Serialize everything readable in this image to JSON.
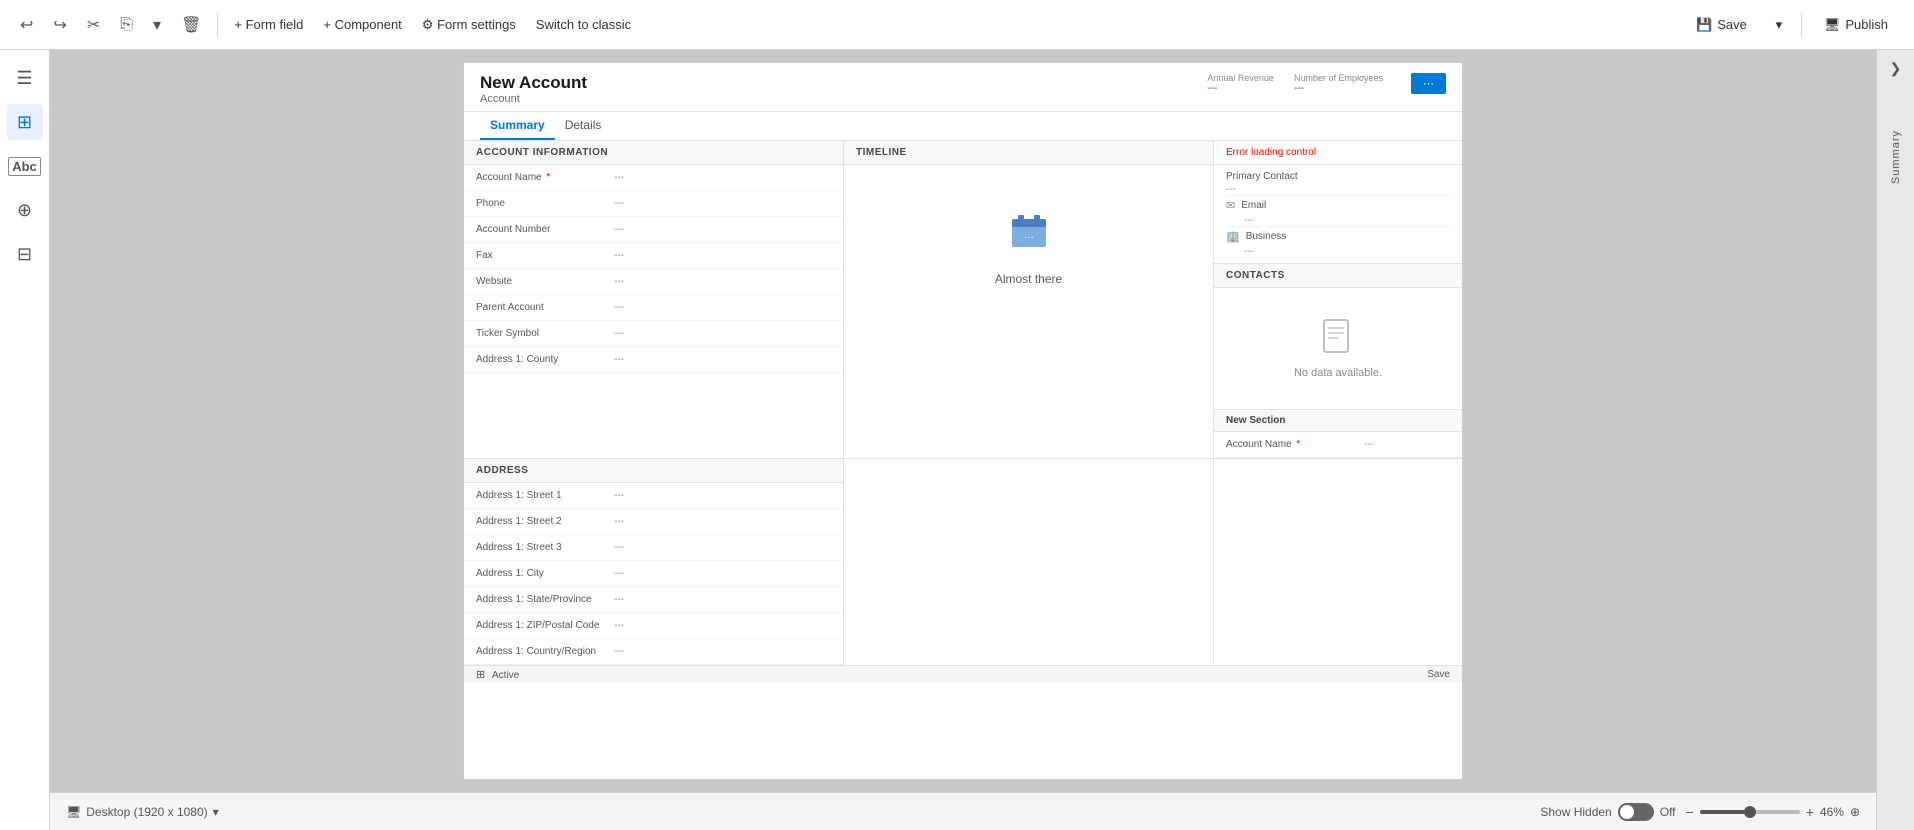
{
  "toolbar": {
    "undo_label": "↩",
    "redo_label": "↪",
    "cut_label": "✂",
    "copy_label": "⎘",
    "dropdown_label": "▾",
    "delete_label": "🗑",
    "form_field_label": "+ Form field",
    "component_label": "+ Component",
    "form_settings_label": "⚙ Form settings",
    "switch_classic_label": "Switch to classic",
    "save_label": "Save",
    "publish_label": "Publish"
  },
  "sidebar": {
    "icons": [
      "☰",
      "⊞",
      "Abc",
      "⊕",
      "⊟"
    ]
  },
  "form": {
    "title": "New Account",
    "subtitle": "Account",
    "header_fields": [
      {
        "label": "Annual Revenue",
        "value": "---"
      },
      {
        "label": "Number of Employees",
        "value": "---"
      }
    ],
    "tabs": [
      {
        "label": "Summary",
        "active": true
      },
      {
        "label": "Details",
        "active": false
      }
    ],
    "account_section": {
      "title": "ACCOUNT INFORMATION",
      "fields": [
        {
          "label": "Account Name",
          "required": true,
          "value": "---"
        },
        {
          "label": "Phone",
          "required": false,
          "value": "---"
        },
        {
          "label": "Account Number",
          "required": false,
          "value": "---"
        },
        {
          "label": "Fax",
          "required": false,
          "value": "---"
        },
        {
          "label": "Website",
          "required": false,
          "value": "---"
        },
        {
          "label": "Parent Account",
          "required": false,
          "value": "---"
        },
        {
          "label": "Ticker Symbol",
          "required": false,
          "value": "---"
        },
        {
          "label": "Address 1: County",
          "required": false,
          "value": "---"
        }
      ]
    },
    "address_section": {
      "title": "ADDRESS",
      "fields": [
        {
          "label": "Address 1: Street 1",
          "value": "---"
        },
        {
          "label": "Address 1: Street 2",
          "value": "---"
        },
        {
          "label": "Address 1: Street 3",
          "value": "---"
        },
        {
          "label": "Address 1: City",
          "value": "---"
        },
        {
          "label": "Address 1: State/Province",
          "value": "---"
        },
        {
          "label": "Address 1: ZIP/Postal Code",
          "value": "---"
        },
        {
          "label": "Address 1: Country/Region",
          "value": "---"
        }
      ]
    },
    "timeline_section": {
      "title": "Timeline",
      "almost_there_icon": "📁",
      "almost_there_text": "Almost there"
    },
    "error_text": "Error loading control",
    "primary_contact": {
      "label": "Primary Contact",
      "value": "---",
      "email_label": "Email",
      "email_value": "---",
      "business_label": "Business",
      "business_value": "---"
    },
    "contacts_section": {
      "title": "CONTACTS",
      "no_data_text": "No data available."
    },
    "new_section": {
      "title": "New Section",
      "field_label": "Account Name",
      "field_required": true,
      "field_value": "---"
    }
  },
  "bottom_bar": {
    "desktop_label": "Desktop (1920 x 1080)",
    "show_hidden_label": "Show Hidden",
    "toggle_state": "Off",
    "zoom_label": "46%",
    "compass_icon": "⊕",
    "status_text": "Active",
    "save_status": "Save"
  },
  "right_panel": {
    "label": "Summary",
    "close_icon": "❯"
  }
}
